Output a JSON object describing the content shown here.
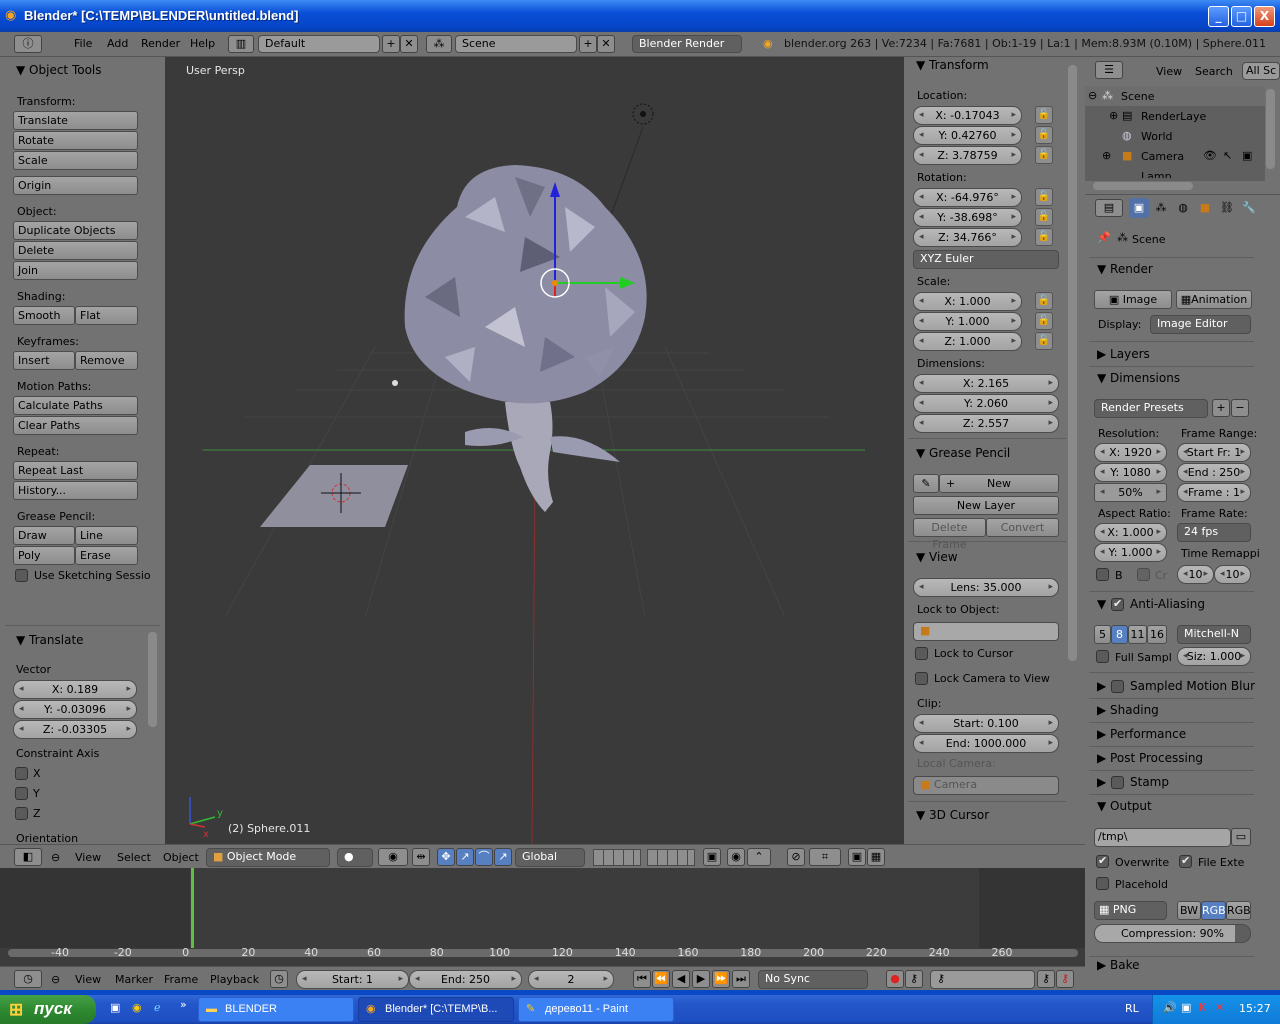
{
  "window": {
    "title": "Blender* [C:\\TEMP\\BLENDER\\untitled.blend]",
    "controls": [
      "_",
      "□",
      "X"
    ]
  },
  "topbar": {
    "menus": [
      "File",
      "Add",
      "Render",
      "Help"
    ],
    "layout": "Default",
    "scene": "Scene",
    "engine": "Blender Render",
    "info": "blender.org 263 | Ve:7234 | Fa:7681 | Ob:1-19 | La:1 | Mem:8.93M (0.10M) | Sphere.011"
  },
  "tools": {
    "header": "Object Tools",
    "transform_label": "Transform:",
    "translate": "Translate",
    "rotate": "Rotate",
    "scale": "Scale",
    "origin": "Origin",
    "object_label": "Object:",
    "duplicate": "Duplicate Objects",
    "delete": "Delete",
    "join": "Join",
    "shading_label": "Shading:",
    "smooth": "Smooth",
    "flat": "Flat",
    "keyframes_label": "Keyframes:",
    "insert": "Insert",
    "remove": "Remove",
    "motion_label": "Motion Paths:",
    "calc_paths": "Calculate Paths",
    "clear_paths": "Clear Paths",
    "repeat_label": "Repeat:",
    "repeat_last": "Repeat Last",
    "history": "History...",
    "gp_label": "Grease Pencil:",
    "draw": "Draw",
    "line": "Line",
    "poly": "Poly",
    "erase": "Erase",
    "sketch": "Use Sketching Sessio"
  },
  "operator": {
    "header": "Translate",
    "vector_label": "Vector",
    "x": "X: 0.189",
    "y": "Y: -0.03096",
    "z": "Z: -0.03305",
    "constraint_label": "Constraint Axis",
    "cx": "X",
    "cy": "Y",
    "cz": "Z",
    "orientation_label": "Orientation"
  },
  "viewport": {
    "persp": "User Persp",
    "object": "(2) Sphere.011"
  },
  "properties": {
    "transform_header": "Transform",
    "location_label": "Location:",
    "loc_x": "X: -0.17043",
    "loc_y": "Y: 0.42760",
    "loc_z": "Z: 3.78759",
    "rotation_label": "Rotation:",
    "rot_x": "X: -64.976°",
    "rot_y": "Y: -38.698°",
    "rot_z": "Z: 34.766°",
    "rot_mode": "XYZ Euler",
    "scale_label": "Scale:",
    "sc_x": "X: 1.000",
    "sc_y": "Y: 1.000",
    "sc_z": "Z: 1.000",
    "dims_label": "Dimensions:",
    "dim_x": "X: 2.165",
    "dim_y": "Y: 2.060",
    "dim_z": "Z: 2.557",
    "gp_header": "Grease Pencil",
    "gp_new": "New",
    "gp_new_layer": "New Layer",
    "gp_delete_frame": "Delete Frame",
    "gp_convert": "Convert",
    "view_header": "View",
    "lens": "Lens: 35.000",
    "lock_obj_label": "Lock to Object:",
    "lock_cursor": "Lock to Cursor",
    "lock_cam": "Lock Camera to View",
    "clip_label": "Clip:",
    "clip_start": "Start: 0.100",
    "clip_end": "End: 1000.000",
    "local_cam_label": "Local Camera:",
    "local_cam": "Camera",
    "cursor_header": "3D Cursor"
  },
  "outliner": {
    "view": "View",
    "search": "Search",
    "all": "All Sc",
    "items": [
      "Scene",
      "RenderLaye",
      "World",
      "Camera",
      "Lamp"
    ]
  },
  "render": {
    "scene": "Scene",
    "render_header": "Render",
    "image": "Image",
    "animation": "Animation",
    "display_label": "Display:",
    "display": "Image Editor",
    "layers": "Layers",
    "dimensions": "Dimensions",
    "presets": "Render Presets",
    "resolution_label": "Resolution:",
    "res_x": "X: 1920",
    "res_y": "Y: 1080",
    "res_pct": "50%",
    "frame_range_label": "Frame Range:",
    "start_fr": "Start Fr: 1",
    "end_fr": "End : 250",
    "frame": "Frame : 1",
    "aspect_label": "Aspect Ratio:",
    "asp_x": "X: 1.000",
    "asp_y": "Y: 1.000",
    "frame_rate_label": "Frame Rate:",
    "fps": "24 fps",
    "time_remap": "Time Remappi",
    "b": "B",
    "cr": "Cr",
    "remap_old": "10",
    "remap_new": "10",
    "aa": "Anti-Aliasing",
    "aa_samples": [
      "5",
      "8",
      "11",
      "16"
    ],
    "filter": "Mitchell-N",
    "full_sample": "Full Sampl",
    "size": "Siz: 1.000",
    "motion_blur": "Sampled Motion Blur",
    "shading": "Shading",
    "performance": "Performance",
    "post": "Post Processing",
    "stamp": "Stamp",
    "output": "Output",
    "path": "/tmp\\",
    "overwrite": "Overwrite",
    "file_ext": "File Exte",
    "placeholder": "Placehold",
    "format": "PNG",
    "bw": "BW",
    "rgb": "RGB",
    "rgba": "RGB",
    "compression": "Compression: 90%",
    "compression_value": 90,
    "bake": "Bake"
  },
  "view3d_header": {
    "view": "View",
    "select": "Select",
    "object": "Object",
    "mode": "Object Mode",
    "orientation": "Global"
  },
  "timeline": {
    "ticks": [
      "-40",
      "-20",
      "0",
      "20",
      "40",
      "60",
      "80",
      "100",
      "120",
      "140",
      "160",
      "180",
      "200",
      "220",
      "240",
      "260"
    ],
    "view": "View",
    "marker": "Marker",
    "frame": "Frame",
    "playback": "Playback",
    "start": "Start: 1",
    "end": "End: 250",
    "current": "2",
    "sync": "No Sync"
  },
  "taskbar": {
    "start": "пуск",
    "tasks": [
      "BLENDER",
      "Blender* [C:\\TEMP\\B...",
      "дерево11 - Paint"
    ],
    "lang": "RL",
    "clock": "15:27"
  }
}
